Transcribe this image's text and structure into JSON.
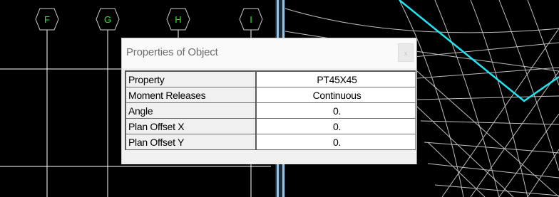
{
  "grid_bubbles": [
    "F",
    "G",
    "H",
    "I"
  ],
  "colors": {
    "background": "#000000",
    "grid_bubble": "#2ee82e",
    "grid_line": "#ffffff",
    "highlight_line": "#1ee6f2",
    "separator": "#7fa8c8"
  },
  "dialog": {
    "title": "Properties of Object",
    "close_label": "x",
    "rows": [
      {
        "property": "Property",
        "value": "PT45X45"
      },
      {
        "property": "Moment Releases",
        "value": "Continuous"
      },
      {
        "property": "Angle",
        "value": "0."
      },
      {
        "property": "Plan Offset X",
        "value": "0."
      },
      {
        "property": "Plan Offset Y",
        "value": "0."
      }
    ]
  }
}
